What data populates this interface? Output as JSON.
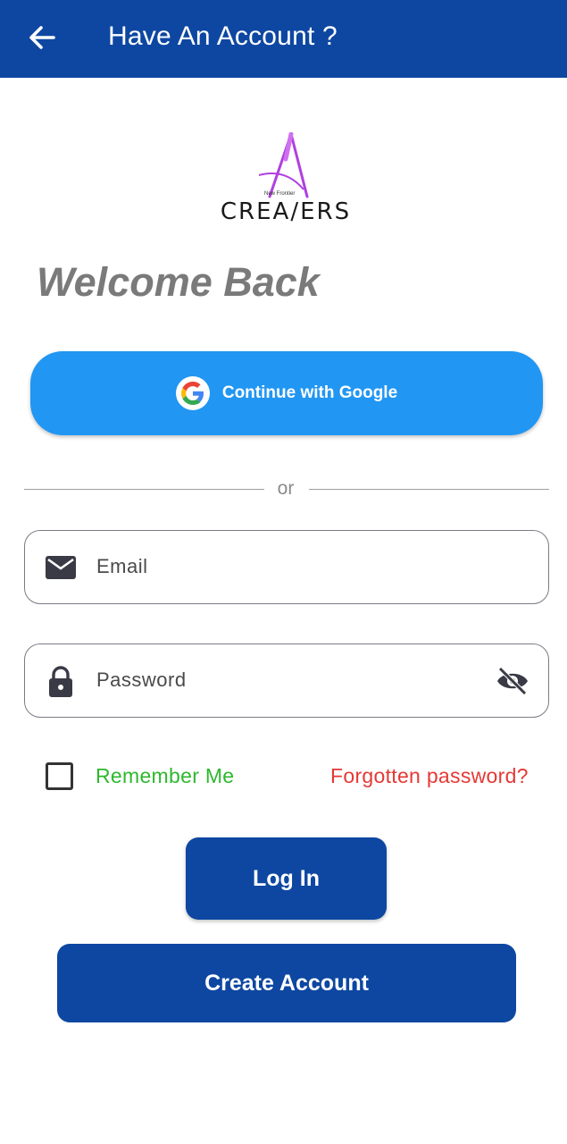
{
  "appbar": {
    "title": "Have An Account  ?",
    "back_icon": "arrow-left-icon",
    "background": "#0d47a1"
  },
  "logo": {
    "wordmark": "CREA/ERS",
    "tagline": "New Frontier",
    "accent": "#b040e0"
  },
  "welcome": "Welcome Back",
  "google_button": {
    "label": "Continue with Google",
    "icon": "google-icon",
    "color": "#2196f3"
  },
  "divider": {
    "text": "or"
  },
  "email": {
    "placeholder": "Email",
    "value": "",
    "icon": "mail-icon"
  },
  "password": {
    "placeholder": "Password",
    "value": "",
    "icon": "lock-icon",
    "toggle_icon": "eye-off-icon"
  },
  "remember": {
    "label": "Remember Me",
    "checked": false,
    "color": "#2eb82e"
  },
  "forgot": {
    "label": "Forgotten password?",
    "color": "#e53935"
  },
  "actions": {
    "login_label": "Log In",
    "create_label": "Create Account",
    "color": "#0d47a1"
  }
}
